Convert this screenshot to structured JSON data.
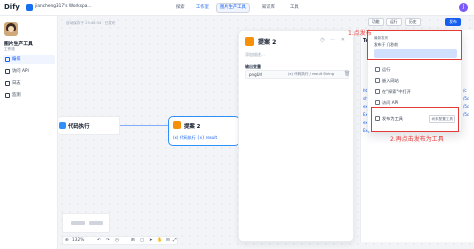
{
  "topbar": {
    "logo": "Dify",
    "workspace": "jiancheng317's Workspa...",
    "nav": [
      "探索",
      "工作室",
      "知识库",
      "工具"
    ],
    "active_nav": "工作室",
    "app_chip": "图片生产工具",
    "user_initial": "J"
  },
  "sidebar": {
    "app_name": "图片生产工具",
    "app_type": "工作流",
    "items": [
      {
        "label": "编排",
        "active": true
      },
      {
        "label": "访问 API",
        "active": false
      },
      {
        "label": "日志",
        "active": false
      },
      {
        "label": "监测",
        "active": false
      }
    ]
  },
  "canvas": {
    "saved_status": "自动保存于 23:46:34 · 已发布",
    "toolbar": {
      "features": "功能",
      "run": "运行",
      "history": "历史",
      "publish": "发布"
    },
    "node_left_label": "代码执行",
    "node_right": {
      "label": "提案 2",
      "var": "(x) 代码执行 {x} result"
    },
    "zoom": "132%",
    "bottom_icons": [
      "undo",
      "redo",
      "pointer",
      "hand",
      "layout",
      "maximize"
    ]
  },
  "panel": {
    "title": "提案 2",
    "desc": "添加描述...",
    "section": "输出变量",
    "row_key": "pngUrl",
    "row_val": "(x) 代码执行 / result String"
  },
  "edge_panel": {
    "title": "Ter",
    "left_links": [
      "http",
      "shar",
      "exp",
      "Exp",
      "exp",
      "Exp"
    ],
    "right_links": [
      "/c",
      "/5c",
      "/5c",
      "/5c"
    ]
  },
  "dropdown": {
    "top_label": "最新发布",
    "top_value": "发布于 几秒前",
    "items": [
      {
        "label": "运行",
        "icon": "play-icon"
      },
      {
        "label": "嵌入网站",
        "icon": "embed-icon"
      },
      {
        "label": "在\"探索\"中打开",
        "icon": "explore-icon"
      },
      {
        "label": "访问 API",
        "icon": "api-icon"
      },
      {
        "label": "发布为工具",
        "icon": "tool-icon",
        "badge": "尚未配置工具"
      }
    ]
  },
  "annotations": {
    "step1": "1.点发布",
    "step2": "2.再点击发布为工具"
  },
  "colors": {
    "accent": "#155eef",
    "annotation": "#e53935",
    "node_orange": "#f79009"
  }
}
